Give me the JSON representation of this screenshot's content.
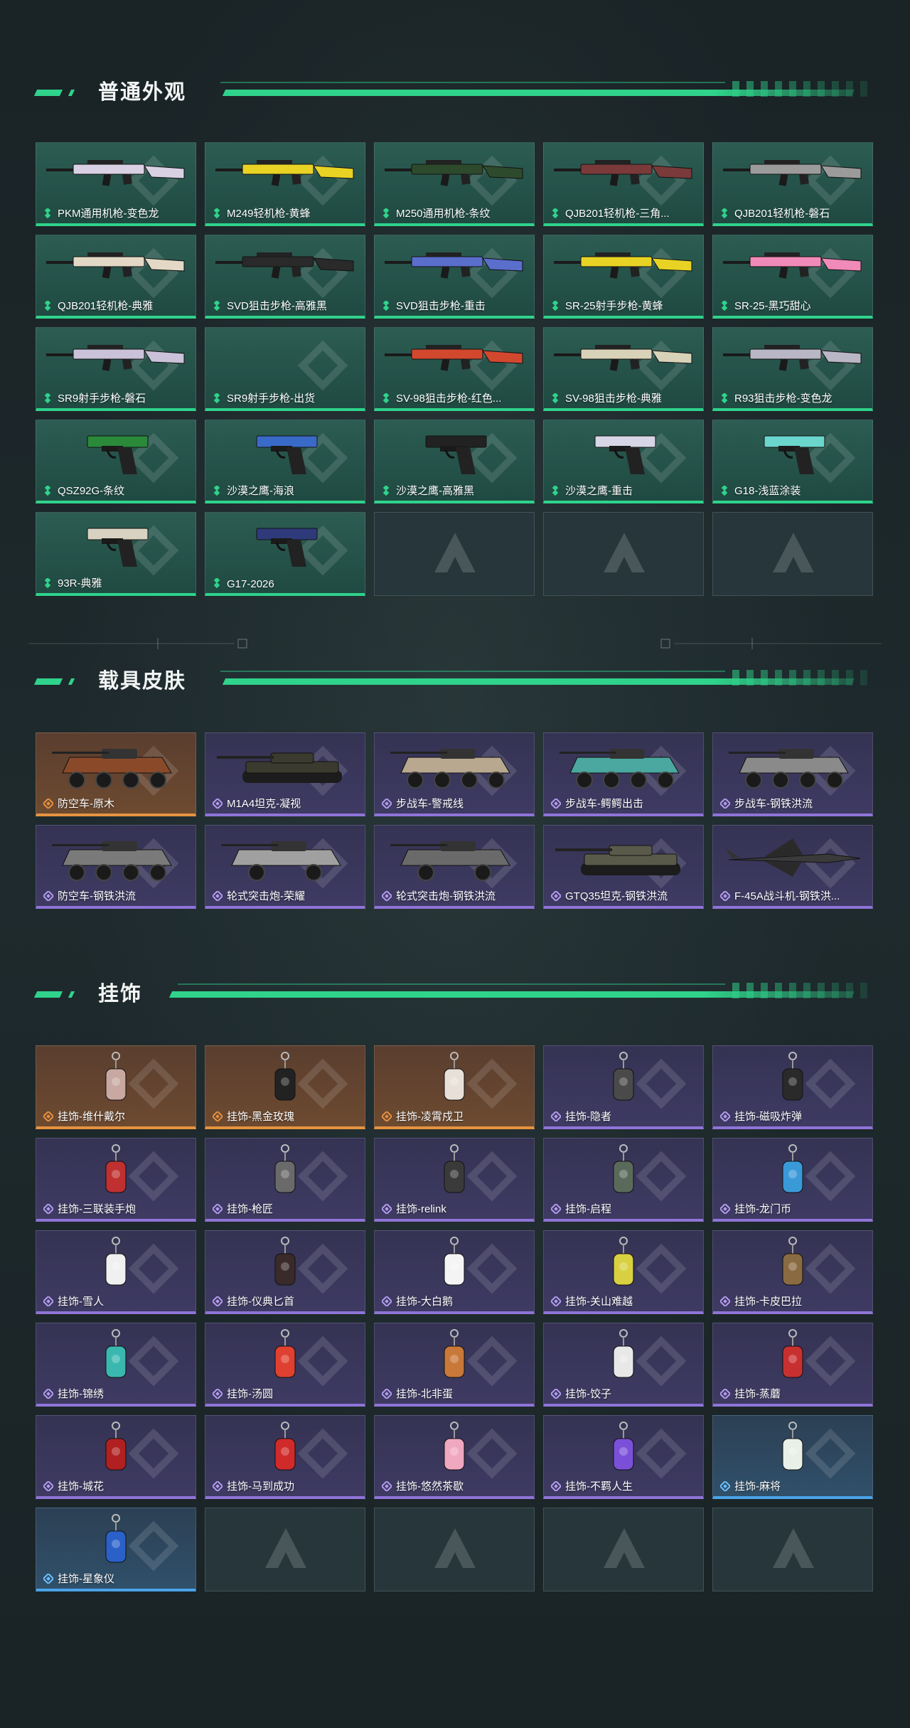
{
  "sections": {
    "weapons": {
      "title": "普通外观",
      "items": [
        {
          "label": "PKM通用机枪-变色龙",
          "rarity": "green",
          "color": "#d9d0e4"
        },
        {
          "label": "M249轻机枪-黄蜂",
          "rarity": "green",
          "color": "#e8d325"
        },
        {
          "label": "M250通用机枪-条纹",
          "rarity": "green",
          "color": "#2e4a2c"
        },
        {
          "label": "QJB201轻机枪-三角...",
          "rarity": "green",
          "color": "#7a3a3a"
        },
        {
          "label": "QJB201轻机枪-磐石",
          "rarity": "green",
          "color": "#9b9b9b"
        },
        {
          "label": "QJB201轻机枪-典雅",
          "rarity": "green",
          "color": "#e2d8c5"
        },
        {
          "label": "SVD狙击步枪-高雅黑",
          "rarity": "green",
          "color": "#2a2a2a"
        },
        {
          "label": "SVD狙击步枪-重击",
          "rarity": "green",
          "color": "#5a6ecc"
        },
        {
          "label": "SR-25射手步枪-黄蜂",
          "rarity": "green",
          "color": "#e8d325"
        },
        {
          "label": "SR-25-黑巧甜心",
          "rarity": "green",
          "color": "#f08ab8"
        },
        {
          "label": "SR9射手步枪-磐石",
          "rarity": "green",
          "color": "#c9c2d8"
        },
        {
          "label": "SR9射手步枪-出货",
          "rarity": "green",
          "color": ""
        },
        {
          "label": "SV-98狙击步枪-红色...",
          "rarity": "green",
          "color": "#d2482e"
        },
        {
          "label": "SV-98狙击步枪-典雅",
          "rarity": "green",
          "color": "#d8d2b8"
        },
        {
          "label": "R93狙击步枪-变色龙",
          "rarity": "green",
          "color": "#b9b6c6"
        },
        {
          "label": "QSZ92G-条纹",
          "rarity": "green",
          "color": "#2a8a3a"
        },
        {
          "label": "沙漠之鹰-海浪",
          "rarity": "green",
          "color": "#3a6ac8"
        },
        {
          "label": "沙漠之鹰-高雅黑",
          "rarity": "green",
          "color": "#222222"
        },
        {
          "label": "沙漠之鹰-重击",
          "rarity": "green",
          "color": "#d6d6e6"
        },
        {
          "label": "G18-浅蓝涂装",
          "rarity": "green",
          "color": "#6ad6cc"
        },
        {
          "label": "93R-典雅",
          "rarity": "green",
          "color": "#d8d2c0"
        },
        {
          "label": "G17-2026",
          "rarity": "green",
          "color": "#2e3a7a"
        },
        {
          "label": "",
          "rarity": "empty",
          "color": ""
        },
        {
          "label": "",
          "rarity": "empty",
          "color": ""
        },
        {
          "label": "",
          "rarity": "empty",
          "color": ""
        }
      ]
    },
    "vehicles": {
      "title": "载具皮肤",
      "items": [
        {
          "label": "防空车-原木",
          "rarity": "orange",
          "color": "#8a4a2a"
        },
        {
          "label": "M1A4坦克-凝视",
          "rarity": "purple",
          "color": "#3a3a2e"
        },
        {
          "label": "步战车-警戒线",
          "rarity": "purple",
          "color": "#b8a890"
        },
        {
          "label": "步战车-鳄鳄出击",
          "rarity": "purple",
          "color": "#4aa8a0"
        },
        {
          "label": "步战车-钢铁洪流",
          "rarity": "purple",
          "color": "#8a8a8a"
        },
        {
          "label": "防空车-钢铁洪流",
          "rarity": "purple",
          "color": "#7a7a7a"
        },
        {
          "label": "轮式突击炮-荣耀",
          "rarity": "purple",
          "color": "#a0a0a0"
        },
        {
          "label": "轮式突击炮-钢铁洪流",
          "rarity": "purple",
          "color": "#6a6a6a"
        },
        {
          "label": "GTQ35坦克-钢铁洪流",
          "rarity": "purple",
          "color": "#5a5a4a"
        },
        {
          "label": "F-45A战斗机-钢铁洪...",
          "rarity": "purple",
          "color": "#3a3a3a"
        }
      ]
    },
    "charms": {
      "title": "挂饰",
      "items": [
        {
          "label": "挂饰-维什戴尔",
          "rarity": "orange",
          "color": "#c8a8a0"
        },
        {
          "label": "挂饰-黑金玫瑰",
          "rarity": "orange",
          "color": "#222222"
        },
        {
          "label": "挂饰-凌霄戍卫",
          "rarity": "orange",
          "color": "#e8e0d8"
        },
        {
          "label": "挂饰-隐者",
          "rarity": "purple",
          "color": "#4a4a4a"
        },
        {
          "label": "挂饰-磁吸炸弹",
          "rarity": "purple",
          "color": "#2a2a2a"
        },
        {
          "label": "挂饰-三联装手炮",
          "rarity": "purple",
          "color": "#c03030"
        },
        {
          "label": "挂饰-枪匠",
          "rarity": "purple",
          "color": "#6a6a6a"
        },
        {
          "label": "挂饰-relink",
          "rarity": "purple",
          "color": "#3a3a3a"
        },
        {
          "label": "挂饰-启程",
          "rarity": "purple",
          "color": "#5a6a5a"
        },
        {
          "label": "挂饰-龙门币",
          "rarity": "purple",
          "color": "#3a9ad8"
        },
        {
          "label": "挂饰-雪人",
          "rarity": "purple",
          "color": "#f0f0f0"
        },
        {
          "label": "挂饰-仪典匕首",
          "rarity": "purple",
          "color": "#3a2a2a"
        },
        {
          "label": "挂饰-大白鹅",
          "rarity": "purple",
          "color": "#f4f4f4"
        },
        {
          "label": "挂饰-关山难越",
          "rarity": "purple",
          "color": "#d8d040"
        },
        {
          "label": "挂饰-卡皮巴拉",
          "rarity": "purple",
          "color": "#8a6a40"
        },
        {
          "label": "挂饰-锦绣",
          "rarity": "purple",
          "color": "#3ab8b0"
        },
        {
          "label": "挂饰-汤圆",
          "rarity": "purple",
          "color": "#e04030"
        },
        {
          "label": "挂饰-北非蛋",
          "rarity": "purple",
          "color": "#c87838"
        },
        {
          "label": "挂饰-饺子",
          "rarity": "purple",
          "color": "#e8e8e8"
        },
        {
          "label": "挂饰-蒸蘑",
          "rarity": "purple",
          "color": "#c83030"
        },
        {
          "label": "挂饰-城花",
          "rarity": "purple",
          "color": "#b02020"
        },
        {
          "label": "挂饰-马到成功",
          "rarity": "purple",
          "color": "#d02a2a"
        },
        {
          "label": "挂饰-悠然茶歇",
          "rarity": "purple",
          "color": "#f0a8c0"
        },
        {
          "label": "挂饰-不羁人生",
          "rarity": "purple",
          "color": "#7a50d8"
        },
        {
          "label": "挂饰-麻将",
          "rarity": "blue",
          "color": "#e8f0e8"
        },
        {
          "label": "挂饰-星象仪",
          "rarity": "blue",
          "color": "#2a60c8"
        },
        {
          "label": "",
          "rarity": "empty",
          "color": ""
        },
        {
          "label": "",
          "rarity": "empty",
          "color": ""
        },
        {
          "label": "",
          "rarity": "empty",
          "color": ""
        },
        {
          "label": "",
          "rarity": "empty",
          "color": ""
        }
      ]
    }
  },
  "colors": {
    "accent": "#2fd38b",
    "orange": "#e69340",
    "purple": "#8f74d8",
    "blue": "#4aa3e8"
  }
}
